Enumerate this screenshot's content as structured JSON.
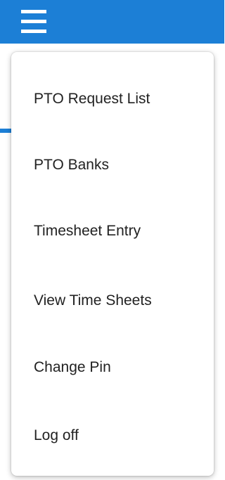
{
  "header": {
    "menu_icon": "hamburger-menu-icon",
    "background_color": "#1c7fd6"
  },
  "menu": {
    "items": [
      {
        "label": "PTO Request List"
      },
      {
        "label": "PTO Banks"
      },
      {
        "label": "Timesheet Entry"
      },
      {
        "label": "View Time Sheets"
      },
      {
        "label": "Change Pin"
      },
      {
        "label": "Log off"
      }
    ]
  }
}
